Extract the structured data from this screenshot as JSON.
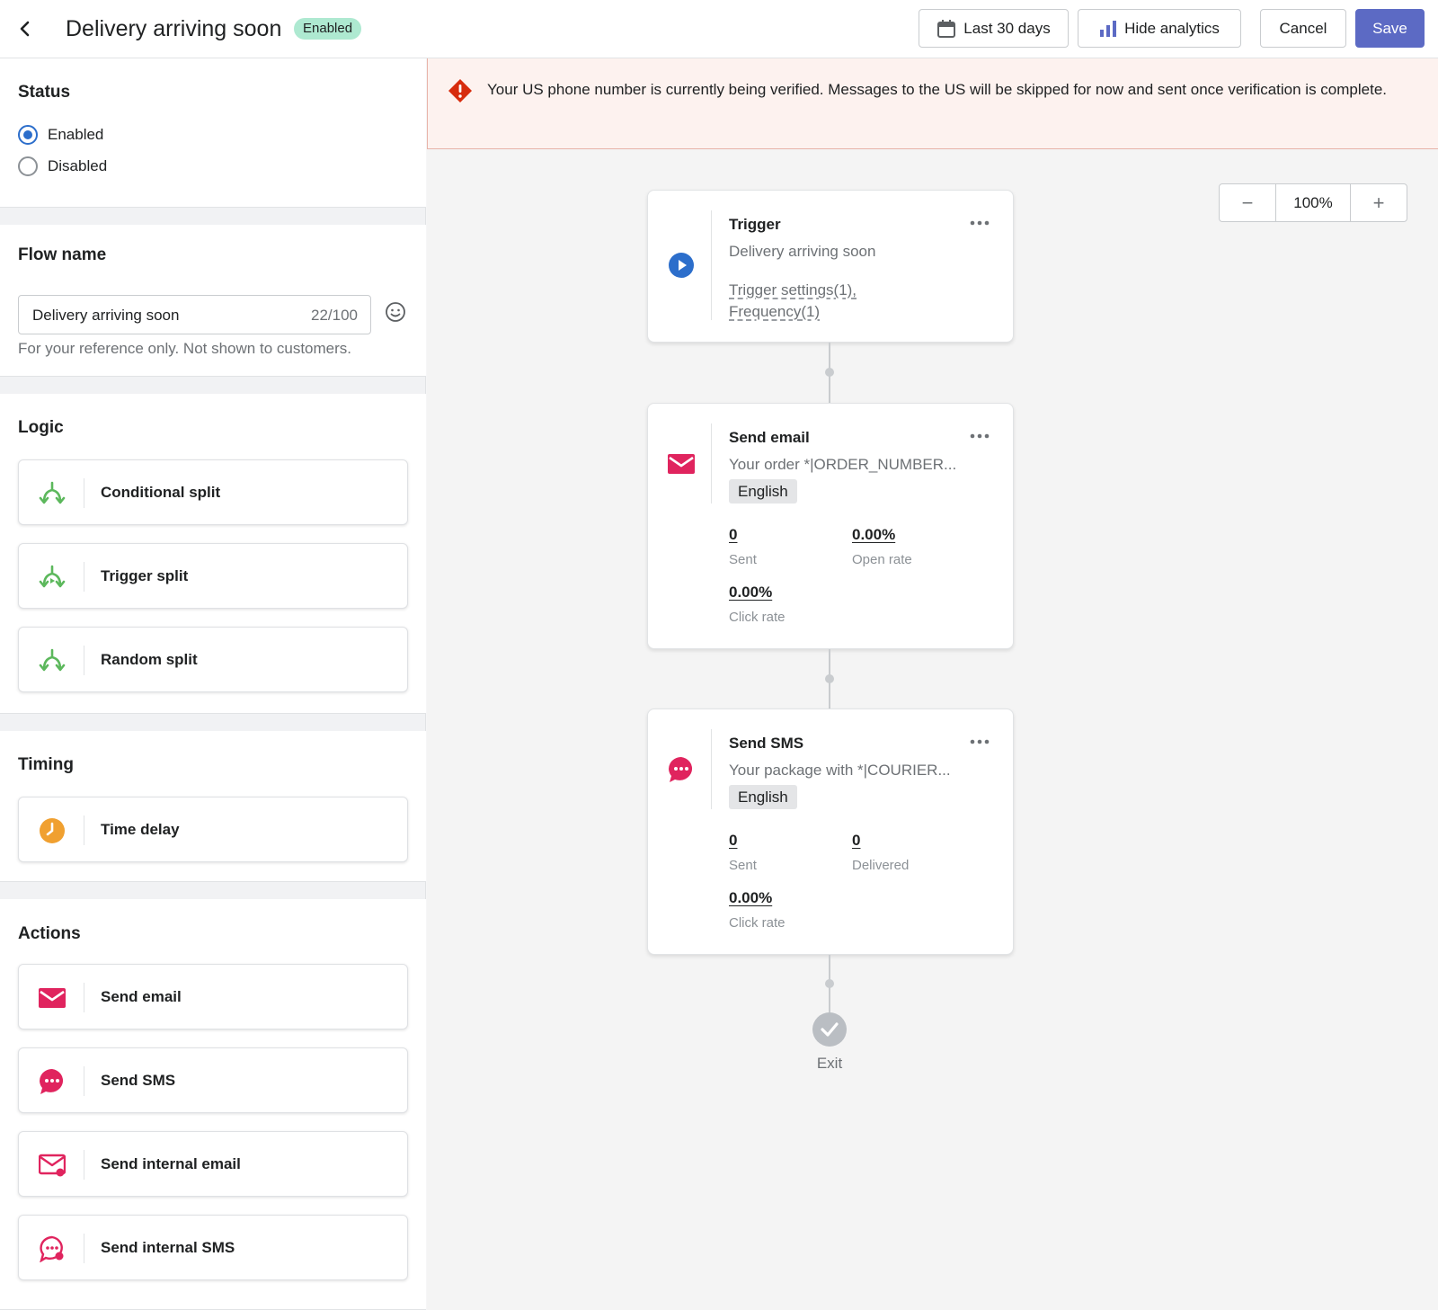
{
  "header": {
    "title": "Delivery arriving soon",
    "badge": "Enabled",
    "date_range": "Last 30 days",
    "analytics_label": "Hide analytics",
    "cancel_label": "Cancel",
    "save_label": "Save"
  },
  "sidebar": {
    "status": {
      "title": "Status",
      "options": [
        "Enabled",
        "Disabled"
      ],
      "selected": "Enabled"
    },
    "flow_name": {
      "title": "Flow name",
      "value": "Delivery arriving soon",
      "counter": "22/100",
      "help": "For your reference only. Not shown to customers."
    },
    "logic": {
      "title": "Logic",
      "items": [
        "Conditional split",
        "Trigger split",
        "Random split"
      ]
    },
    "timing": {
      "title": "Timing",
      "items": [
        "Time delay"
      ]
    },
    "actions": {
      "title": "Actions",
      "items": [
        "Send email",
        "Send SMS",
        "Send internal email",
        "Send internal SMS"
      ]
    }
  },
  "banner": {
    "message": "Your US phone number is currently being verified. Messages to the US will be skipped for now and sent once verification is complete."
  },
  "zoom": {
    "minus": "−",
    "level": "100%",
    "plus": "+"
  },
  "flow": {
    "trigger": {
      "title": "Trigger",
      "subtitle": "Delivery arriving soon",
      "link1": "Trigger settings(1),",
      "link2": "Frequency(1)"
    },
    "email": {
      "title": "Send email",
      "subtitle": "Your order *|ORDER_NUMBER...",
      "language": "English",
      "stats": [
        {
          "value": "0",
          "label": "Sent"
        },
        {
          "value": "0.00%",
          "label": "Open rate"
        },
        {
          "value": "0.00%",
          "label": "Click rate"
        }
      ]
    },
    "sms": {
      "title": "Send SMS",
      "subtitle": "Your package with *|COURIER...",
      "language": "English",
      "stats": [
        {
          "value": "0",
          "label": "Sent"
        },
        {
          "value": "0",
          "label": "Delivered"
        },
        {
          "value": "0.00%",
          "label": "Click rate"
        }
      ]
    },
    "exit_label": "Exit"
  },
  "colors": {
    "accent": "#5c6ac4",
    "radio": "#2c6ecb",
    "logic_green": "#5cb85c",
    "timing_orange": "#f0a030",
    "action_pink": "#e0245e",
    "warning_red": "#d72c0d"
  }
}
